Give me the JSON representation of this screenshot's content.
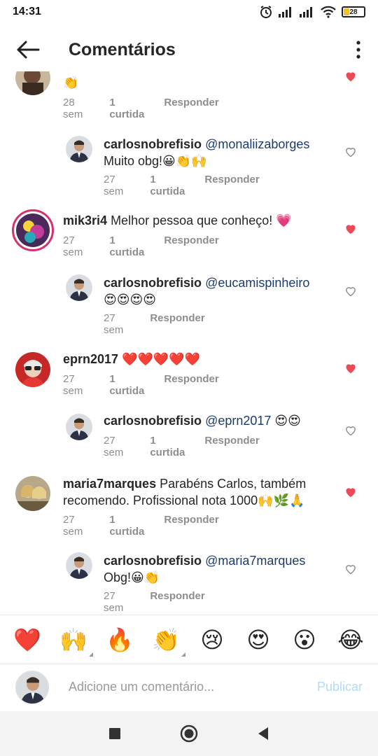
{
  "status_bar": {
    "time": "14:31",
    "battery": "28"
  },
  "header": {
    "title": "Comentários"
  },
  "comments": [
    {
      "id": "c0",
      "text": "👏",
      "time": "28 sem",
      "likes": "1 curtida",
      "reply": "Responder",
      "liked": true
    },
    {
      "id": "c1",
      "user": "carlosnobrefisio",
      "mention": "@monaliizaborges",
      "text": "Muito obg!😀👏🙌",
      "time": "27 sem",
      "likes": "1 curtida",
      "reply": "Responder",
      "liked": false
    },
    {
      "id": "c2",
      "user": "mik3ri4",
      "text": "Melhor pessoa que conheço! 💗",
      "time": "27 sem",
      "likes": "1 curtida",
      "reply": "Responder",
      "liked": true
    },
    {
      "id": "c3",
      "user": "carlosnobrefisio",
      "mention": "@eucamispinheiro",
      "text": "😍😍😍😍",
      "time": "27 sem",
      "reply": "Responder",
      "liked": false
    },
    {
      "id": "c4",
      "user": "eprn2017",
      "text": "❤️❤️❤️❤️❤️",
      "time": "27 sem",
      "likes": "1 curtida",
      "reply": "Responder",
      "liked": true
    },
    {
      "id": "c5",
      "user": "carlosnobrefisio",
      "mention": "@eprn2017",
      "text": "😍😍",
      "time": "27 sem",
      "likes": "1 curtida",
      "reply": "Responder",
      "liked": false
    },
    {
      "id": "c6",
      "user": "maria7marques",
      "text": "Parabéns Carlos, também recomendo. Profissional nota 1000🙌🌿🙏",
      "time": "27 sem",
      "likes": "1 curtida",
      "reply": "Responder",
      "liked": true
    },
    {
      "id": "c7",
      "user": "carlosnobrefisio",
      "mention": "@maria7marques",
      "text": "Obg!😀👏",
      "time": "27 sem",
      "reply": "Responder",
      "liked": false
    }
  ],
  "emoji_bar": [
    "❤️",
    "🙌",
    "🔥",
    "👏",
    "😢",
    "😍",
    "😮",
    "😂"
  ],
  "composer": {
    "placeholder": "Adicione um comentário...",
    "publish": "Publicar"
  },
  "colors": {
    "heart_liked": "#ed4956",
    "mention": "#1c3b6b",
    "publish_disabled": "#b3dbf6",
    "meta": "#8e8e8e"
  }
}
